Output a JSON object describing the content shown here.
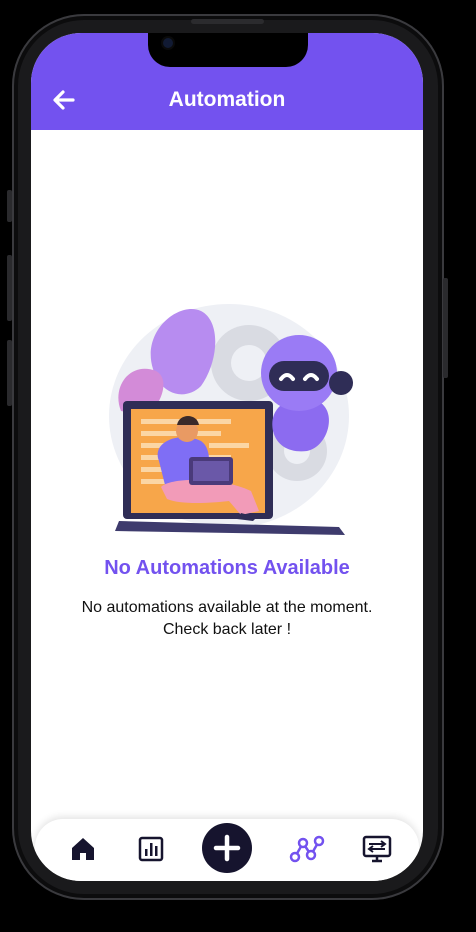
{
  "header": {
    "title": "Automation",
    "back_icon": "arrow-left-icon"
  },
  "empty_state": {
    "illustration": "robot-and-person-with-laptop-illustration",
    "title": "No Automations Available",
    "message_line1": "No automations available at the moment.",
    "message_line2": "Check back later !"
  },
  "bottom_nav": {
    "items": [
      {
        "name": "home",
        "icon": "home-icon",
        "active": false
      },
      {
        "name": "reports",
        "icon": "bar-chart-icon",
        "active": false
      },
      {
        "name": "add",
        "icon": "plus-icon",
        "active": false
      },
      {
        "name": "automation",
        "icon": "nodes-icon",
        "active": true
      },
      {
        "name": "devices",
        "icon": "monitor-settings-icon",
        "active": false
      }
    ]
  },
  "colors": {
    "brand": "#7352ef",
    "nav_dark": "#16142e",
    "text": "#111111",
    "background": "#ffffff"
  }
}
